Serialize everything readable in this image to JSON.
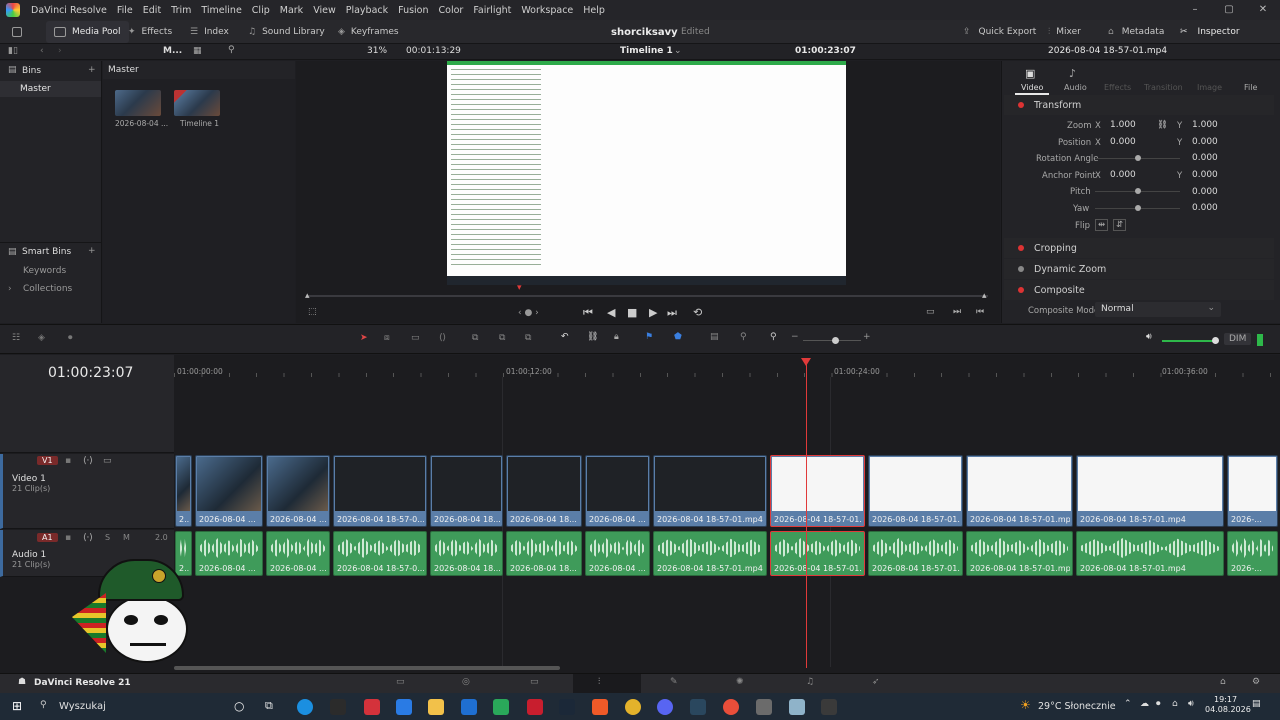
{
  "app": {
    "menu": [
      "DaVinci Resolve",
      "File",
      "Edit",
      "Trim",
      "Timeline",
      "Clip",
      "Mark",
      "View",
      "Playback",
      "Fusion",
      "Color",
      "Fairlight",
      "Workspace",
      "Help"
    ]
  },
  "toolbar": {
    "media_pool": "Media Pool",
    "effects": "Effects",
    "index": "Index",
    "sound_library": "Sound Library",
    "keyframes": "Keyframes",
    "project_name": "shorciksavy",
    "project_state": "Edited",
    "quick_export": "Quick Export",
    "mixer": "Mixer",
    "metadata": "Metadata",
    "inspector": "Inspector"
  },
  "viewer_bar": {
    "pool_label": "M...",
    "zoom": "31%",
    "source_tc": "00:01:13:29",
    "timeline_name": "Timeline 1",
    "timeline_tc": "01:00:23:07",
    "clip_name": "2026-08-04 18-57-01.mp4"
  },
  "bins": {
    "header": "Bins",
    "master": "Master",
    "smart_bins": "Smart Bins",
    "keywords": "Keywords",
    "collections": "Collections"
  },
  "media_pool": {
    "path": "Master",
    "items": [
      "2026-08-04 ...",
      "Timeline 1"
    ]
  },
  "inspector": {
    "tabs": [
      "Video",
      "Audio",
      "Effects",
      "Transition",
      "Image",
      "File"
    ],
    "transform": "Transform",
    "zoom_label": "Zoom",
    "zoom_x": "1.000",
    "zoom_y": "1.000",
    "position_label": "Position",
    "position_x": "0.000",
    "position_y": "0.000",
    "rotation_label": "Rotation Angle",
    "rotation": "0.000",
    "anchor_label": "Anchor Point",
    "anchor_x": "0.000",
    "anchor_y": "0.000",
    "pitch_label": "Pitch",
    "pitch": "0.000",
    "yaw_label": "Yaw",
    "yaw": "0.000",
    "flip_label": "Flip",
    "x": "X",
    "y": "Y",
    "cropping": "Cropping",
    "dynamic_zoom": "Dynamic Zoom",
    "composite": "Composite",
    "composite_mode_label": "Composite Mode",
    "composite_mode": "Normal"
  },
  "timeline": {
    "timecode": "01:00:23:07",
    "ruler": [
      "01:00:00:00",
      "01:00:12:00",
      "01:00:24:00",
      "01:00:36:00"
    ],
    "dim": "DIM",
    "v1_tag": "V1",
    "v1_name": "Video 1",
    "v1_clips": "21 Clip(s)",
    "a1_tag": "A1",
    "a1_name": "Audio 1",
    "a1_clips": "21 Clip(s)",
    "a1_s": "S",
    "a1_m": "M",
    "a1_level": "2.0",
    "video_clips": [
      "2...",
      "2026-08-04 ...",
      "2026-08-04 ...",
      "2026-08-04 18-57-0...",
      "2026-08-04 18...",
      "2026-08-04 18...",
      "2026-08-04 ...",
      "2026-08-04 18-57-01.mp4",
      "2026-08-04 18-57-01...",
      "2026-08-04 18-57-01...",
      "2026-08-04 18-57-01.mp4",
      "2026-08-04 18-57-01.mp4",
      "2026-..."
    ],
    "audio_clips": [
      "2...",
      "2026-08-04 ...",
      "2026-08-04 ...",
      "2026-08-04 18-57-0...",
      "2026-08-04 18...",
      "2026-08-04 18...",
      "2026-08-04 ...",
      "2026-08-04 18-57-01.mp4",
      "2026-08-04 18-57-01...",
      "2026-08-04 18-57-01...",
      "2026-08-04 18-57-01.mp4",
      "2026-08-04 18-57-01.mp4",
      "2026-..."
    ]
  },
  "footer": {
    "brand": "DaVinci Resolve 21"
  },
  "taskbar": {
    "search": "Wyszukaj",
    "weather": "29°C  Słonecznie",
    "time": "19:17",
    "date": "04.08.2026"
  },
  "colors": {
    "playhead": "#e03a3a",
    "video_clip": "#5b7ea8",
    "audio_clip": "#3f9b5a"
  }
}
